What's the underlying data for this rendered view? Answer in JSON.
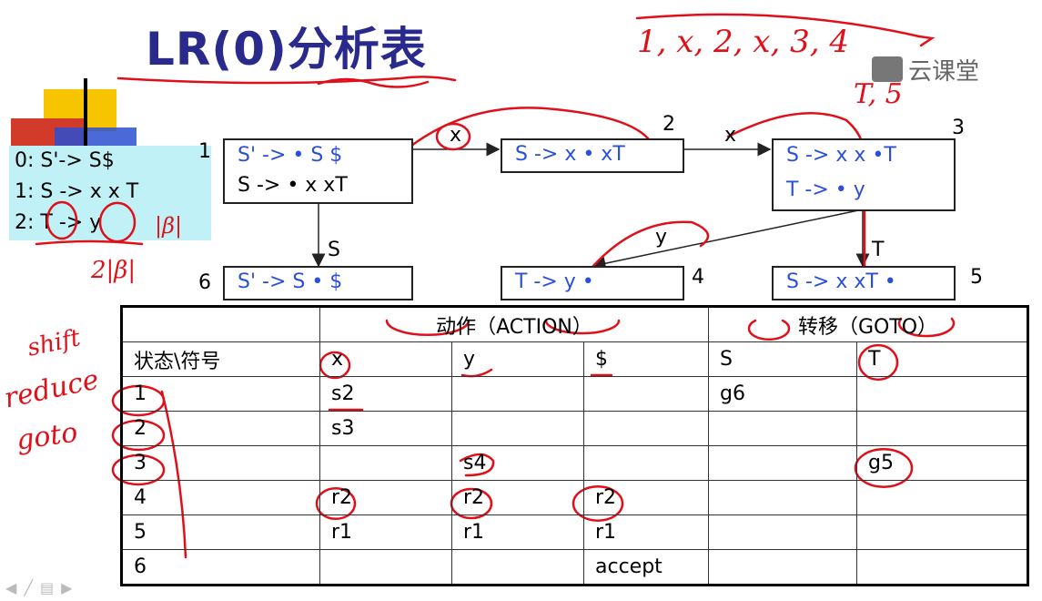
{
  "title": "LR(0)分析表",
  "watermark": "云课堂",
  "grammar": [
    "0: S'-> S$",
    "1: S -> x x T",
    "2: T -> y"
  ],
  "states": [
    {
      "num": "1",
      "lines": [
        "S' -> • S $",
        "S -> • x xT"
      ]
    },
    {
      "num": "2",
      "lines": [
        "S -> x • xT"
      ]
    },
    {
      "num": "3",
      "lines": [
        "S -> x x •T",
        "T -> • y"
      ]
    },
    {
      "num": "4",
      "lines": [
        "T -> y •"
      ]
    },
    {
      "num": "5",
      "lines": [
        "S -> x xT •"
      ]
    },
    {
      "num": "6",
      "lines": [
        "S' -> S • $"
      ]
    }
  ],
  "edges": [
    {
      "label": "x"
    },
    {
      "label": "x"
    },
    {
      "label": "S"
    },
    {
      "label": "y"
    },
    {
      "label": "T"
    }
  ],
  "table": {
    "group_headers": {
      "action": "动作（ACTION）",
      "goto": "转移（GOTO）"
    },
    "columns": [
      "状态\\符号",
      "x",
      "y",
      "$",
      "S",
      "T"
    ],
    "rows": [
      [
        "1",
        "s2",
        "",
        "",
        "g6",
        ""
      ],
      [
        "2",
        "s3",
        "",
        "",
        "",
        ""
      ],
      [
        "3",
        "",
        "s4",
        "",
        "",
        "g5"
      ],
      [
        "4",
        "r2",
        "r2",
        "r2",
        "",
        ""
      ],
      [
        "5",
        "r1",
        "r1",
        "r1",
        "",
        ""
      ],
      [
        "6",
        "",
        "",
        "accept",
        "",
        ""
      ]
    ]
  },
  "annotations": {
    "left_notes": [
      "shift",
      "reduce",
      "goto"
    ],
    "top_right": "1, x, 2, x, 3, 4",
    "top_right_2": "T, 5",
    "under_grammar": "2|β|",
    "beta_note": "|β|"
  },
  "colors": {
    "title": "#2a2a8c",
    "state_text": "#2a4fd8",
    "ink": "#e0101a",
    "grammar_bg": "#bff1f7"
  }
}
